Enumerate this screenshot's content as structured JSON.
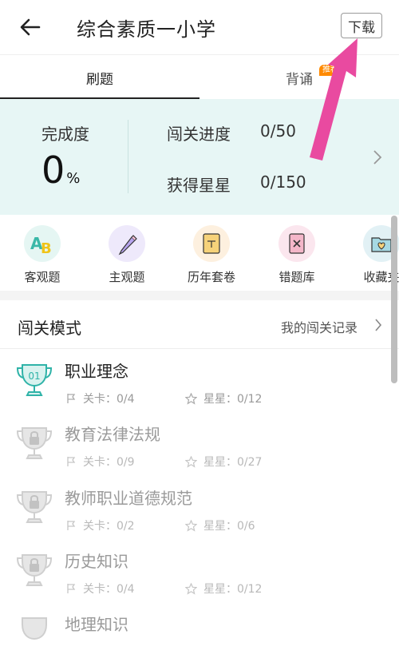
{
  "header": {
    "title": "综合素质一小学",
    "download_label": "下载"
  },
  "tabs": {
    "tab1": "刷题",
    "tab2": "背诵",
    "badge": "推荐"
  },
  "progress": {
    "completion_label": "完成度",
    "completion_value": "0",
    "completion_unit": "%",
    "levels_label": "闯关进度",
    "levels_value": "0/50",
    "stars_label": "获得星星",
    "stars_value": "0/150"
  },
  "categories": [
    {
      "label": "客观题",
      "icon": "ab-icon"
    },
    {
      "label": "主观题",
      "icon": "pencil-icon"
    },
    {
      "label": "历年套卷",
      "icon": "paper-icon"
    },
    {
      "label": "错题库",
      "icon": "wrong-book-icon"
    },
    {
      "label": "收藏夹",
      "icon": "heart-folder-icon"
    }
  ],
  "section": {
    "title": "闯关模式",
    "link": "我的闯关记录"
  },
  "levels": [
    {
      "badge": "01",
      "name": "职业理念",
      "stages": "关卡：0/4",
      "stars": "星星：0/12",
      "locked": false
    },
    {
      "name": "教育法律法规",
      "stages": "关卡：0/9",
      "stars": "星星：0/27",
      "locked": true
    },
    {
      "name": "教师职业道德规范",
      "stages": "关卡：0/2",
      "stars": "星星：0/6",
      "locked": true
    },
    {
      "name": "历史知识",
      "stages": "关卡：0/4",
      "stars": "星星：0/12",
      "locked": true
    },
    {
      "name": "地理知识",
      "locked": true
    }
  ],
  "colors": {
    "panel_bg": "#e7f6f5",
    "accent_teal": "#2fb3a8",
    "annotation_arrow": "#e94aa0",
    "badge": "#ff8a00"
  }
}
